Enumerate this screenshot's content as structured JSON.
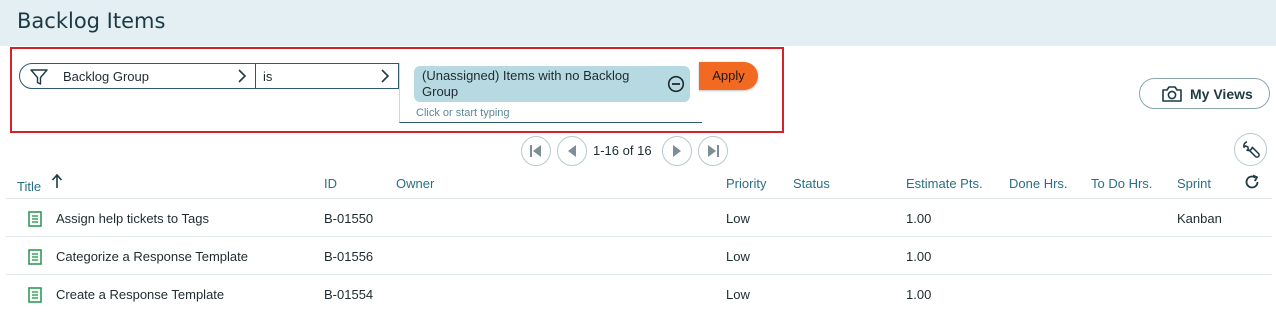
{
  "header": {
    "title": "Backlog Items"
  },
  "filter": {
    "field_label": "Backlog Group",
    "operator_label": "is",
    "value_chip": "(Unassigned) Items with no Backlog Group",
    "value_placeholder": "Click or start typing",
    "apply_label": "Apply"
  },
  "views": {
    "label": "My Views"
  },
  "pager": {
    "range_text": "1-16 of 16"
  },
  "columns": {
    "title": "Title",
    "id": "ID",
    "owner": "Owner",
    "priority": "Priority",
    "status": "Status",
    "estimate": "Estimate Pts.",
    "done": "Done Hrs.",
    "todo": "To Do Hrs.",
    "sprint": "Sprint"
  },
  "rows": [
    {
      "title": "Assign help tickets to Tags",
      "id": "B-01550",
      "owner": "",
      "priority": "Low",
      "status": "",
      "estimate": "1.00",
      "done": "",
      "todo": "",
      "sprint": "Kanban"
    },
    {
      "title": "Categorize a Response Template",
      "id": "B-01556",
      "owner": "",
      "priority": "Low",
      "status": "",
      "estimate": "1.00",
      "done": "",
      "todo": "",
      "sprint": ""
    },
    {
      "title": "Create a Response Template",
      "id": "B-01554",
      "owner": "",
      "priority": "Low",
      "status": "",
      "estimate": "1.00",
      "done": "",
      "todo": "",
      "sprint": ""
    }
  ],
  "colors": {
    "accent": "#f26a21",
    "header_bg": "#e3eff3",
    "chip_bg": "#b7d9e1",
    "link": "#2b6f85",
    "highlight": "#d8202a",
    "story_icon": "#2f9b57"
  },
  "icons": [
    "filter-icon",
    "chevron-right-icon",
    "remove-circle-icon",
    "camera-icon",
    "first-page-icon",
    "previous-page-icon",
    "next-page-icon",
    "last-page-icon",
    "wrench-icon",
    "sort-ascending-icon",
    "refresh-icon",
    "story-icon"
  ]
}
